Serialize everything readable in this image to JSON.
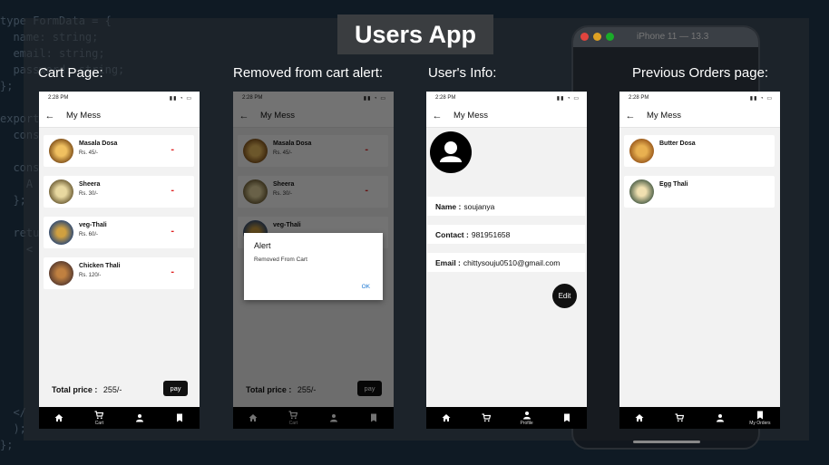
{
  "app_title": "Users App",
  "background": {
    "code_lines": [
      "type FormData = {",
      "  name: string;",
      "  email: string;",
      "  password: string;",
      "};",
      "",
      "export",
      "  cons",
      "",
      "  cons",
      "    A",
      "  };",
      "",
      "  retu",
      "    <",
      "",
      "",
      "",
      "",
      "",
      "",
      "",
      "",
      "",
      "  </",
      "  );",
      "};"
    ],
    "simulator_title": "iPhone 11 — 13.3"
  },
  "labels": {
    "cart": "Cart Page:",
    "alert": "Removed from cart alert:",
    "user": "User's Info:",
    "orders": "Previous Orders page:"
  },
  "phone": {
    "status_time": "2:28 PM",
    "header_title": "My Mess"
  },
  "cart_items": [
    {
      "name": "Masala Dosa",
      "price": "Rs. 45/-",
      "remove": "-"
    },
    {
      "name": "Sheera",
      "price": "Rs. 30/-",
      "remove": "-"
    },
    {
      "name": "veg-Thali",
      "price": "Rs. 60/-",
      "remove": "-"
    },
    {
      "name": "Chicken Thali",
      "price": "Rs. 120/-",
      "remove": "-"
    }
  ],
  "cart": {
    "total_label": "Total price :",
    "total_value": "255/-",
    "pay_label": "pay"
  },
  "alert": {
    "title": "Alert",
    "message": "Removed From Cart",
    "ok": "OK"
  },
  "user": {
    "name_label": "Name :",
    "name_value": "soujanya",
    "contact_label": "Contact :",
    "contact_value": "981951658",
    "email_label": "Email :",
    "email_value": "chittysouju0510@gmail.com",
    "edit_label": "Edit"
  },
  "orders": [
    {
      "name": "Butter Dosa"
    },
    {
      "name": "Egg Thali"
    }
  ],
  "tabs": {
    "cart": "Cart",
    "profile": "Profile",
    "my_orders": "My Orders"
  },
  "colors": {
    "remove": "#e02020",
    "ok": "#1976d2",
    "tabbar": "#000000"
  }
}
